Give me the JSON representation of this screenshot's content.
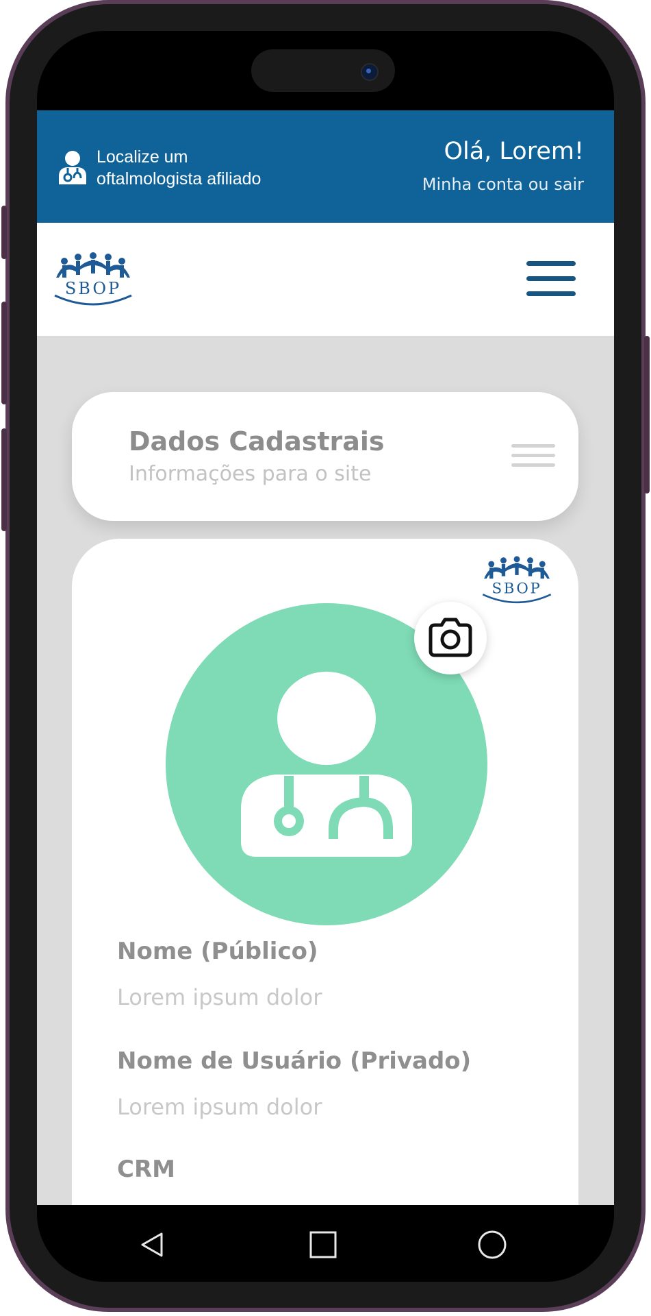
{
  "top_bar": {
    "locate_line1": "Localize um",
    "locate_line2": "oftalmologista afiliado",
    "greeting": "Olá, Lorem!",
    "account_link": "Minha conta ou sair"
  },
  "logo": {
    "text": "SBOP"
  },
  "header_card": {
    "title": "Dados Cadastrais",
    "subtitle": "Informações para o site"
  },
  "profile": {
    "fields": [
      {
        "label": "Nome (Público)",
        "value": "Lorem ipsum dolor"
      },
      {
        "label": "Nome de Usuário (Privado)",
        "value": "Lorem ipsum dolor"
      },
      {
        "label": "CRM",
        "value": ""
      }
    ]
  },
  "colors": {
    "header_blue": "#0f6399",
    "avatar_green": "#7edbb5",
    "page_bg": "#dcdcdc"
  },
  "icons": {
    "locate": "doctor-icon",
    "menu": "hamburger-icon",
    "camera": "camera-icon",
    "avatar": "doctor-avatar-icon",
    "nav_back": "triangle-back-icon",
    "nav_home": "square-home-icon",
    "nav_recent": "circle-recent-icon"
  }
}
